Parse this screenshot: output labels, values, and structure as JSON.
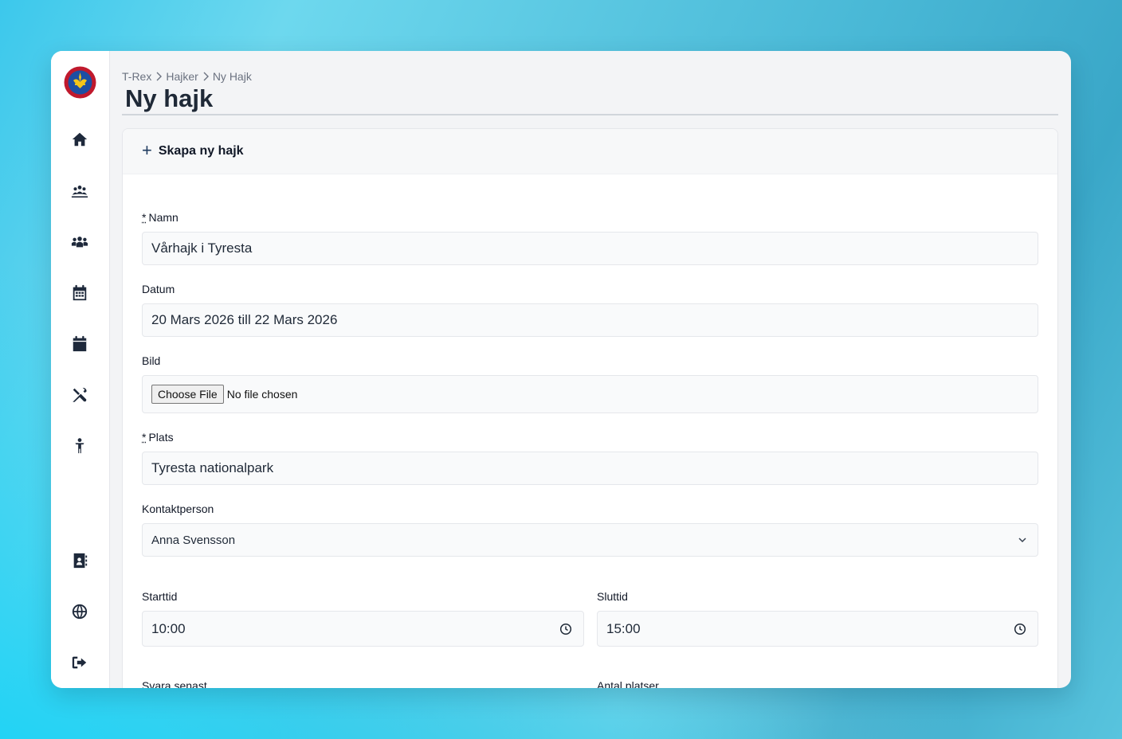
{
  "breadcrumb": [
    "T-Rex",
    "Hajker",
    "Ny Hajk"
  ],
  "page_title": "Ny hajk",
  "card": {
    "title": "Skapa ny hajk"
  },
  "form": {
    "name": {
      "label": "Namn",
      "required_mark": "*",
      "value": "Vårhajk i Tyresta"
    },
    "date": {
      "label": "Datum",
      "value": "20 Mars 2026 till 22 Mars 2026"
    },
    "image": {
      "label": "Bild",
      "button": "Choose File",
      "status": "No file chosen"
    },
    "place": {
      "label": "Plats",
      "required_mark": "*",
      "value": "Tyresta nationalpark"
    },
    "contact": {
      "label": "Kontaktperson",
      "value": "Anna Svensson"
    },
    "start_time": {
      "label": "Starttid",
      "value": "10:00"
    },
    "end_time": {
      "label": "Sluttid",
      "value": "15:00"
    },
    "reply_by": {
      "label": "Svara senast"
    },
    "seats": {
      "label": "Antal platser"
    }
  },
  "sidebar": {
    "icons": [
      "home-icon",
      "group-icon",
      "people-icon",
      "calendar-grid-icon",
      "calendar-icon",
      "tools-icon",
      "child-icon",
      "contact-book-icon",
      "globe-icon",
      "logout-icon"
    ]
  }
}
